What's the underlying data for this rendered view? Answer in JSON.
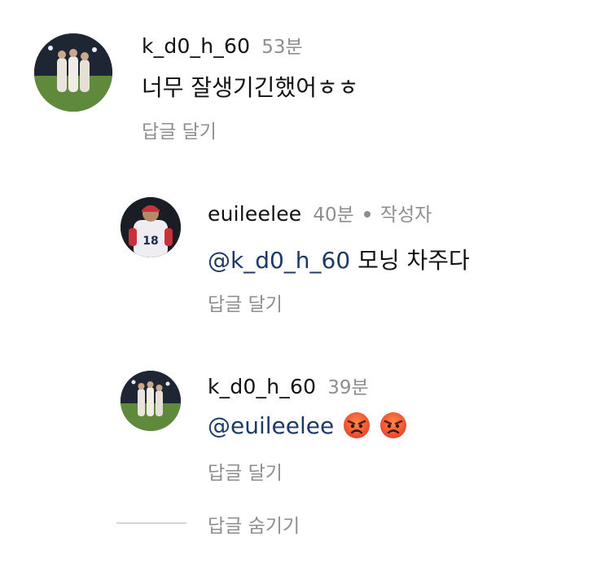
{
  "comments": [
    {
      "username": "k_d0_h_60",
      "time": "53분",
      "text": "너무 잘생기긴했어ㅎㅎ",
      "reply_label": "답글 달기",
      "avatar_icon": "team-photo-avatar"
    },
    {
      "username": "euileelee",
      "time": "40분",
      "author_badge": "작성자",
      "mention": "@k_d0_h_60",
      "text": "모닝 차주다",
      "reply_label": "답글 달기",
      "avatar_icon": "baseball-player-avatar"
    },
    {
      "username": "k_d0_h_60",
      "time": "39분",
      "mention": "@euileelee",
      "emojis": [
        "angry-face-emoji",
        "angry-face-emoji"
      ],
      "reply_label": "답글 달기",
      "avatar_icon": "team-photo-avatar"
    }
  ],
  "hide_replies_label": "답글 숨기기",
  "colors": {
    "mention": "#1d3a66",
    "secondary_text": "#8e8e8e"
  }
}
